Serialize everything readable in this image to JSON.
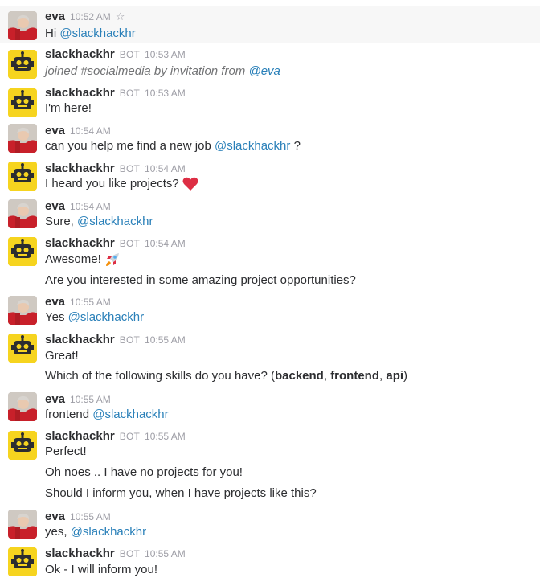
{
  "colors": {
    "mention": "#2a80b9",
    "meta": "#9e9ea6",
    "bot_avatar": "#f6d41f"
  },
  "eva_name": "eva",
  "bot_name": "slackhackhr",
  "bot_badge": "BOT",
  "messages": [
    {
      "time": "10:52 AM",
      "text": "Hi ",
      "mention": "@slackhackhr"
    },
    {
      "time": "10:53 AM",
      "text": "joined #socialmedia by invitation from ",
      "mention": "@eva"
    },
    {
      "time": "10:53 AM",
      "text": "I'm here!"
    },
    {
      "time": "10:54 AM",
      "text": "can you help me find a new job ",
      "mention": "@slackhackhr",
      "suffix": " ?"
    },
    {
      "time": "10:54 AM",
      "text": "I heard you like projects?",
      "emoji": "heart-emoji"
    },
    {
      "time": "10:54 AM",
      "text": "Sure, ",
      "mention": "@slackhackhr"
    },
    {
      "time": "10:54 AM",
      "text": "Awesome!",
      "emoji": "rocket-emoji",
      "line2": "Are you interested in some amazing project opportunities?"
    },
    {
      "time": "10:55 AM",
      "text": "Yes ",
      "mention": "@slackhackhr"
    },
    {
      "time": "10:55 AM",
      "text": "Great!",
      "line2_prefix": "Which of the following skills do you have? (",
      "skills": [
        "backend",
        "frontend",
        "api"
      ],
      "line2_suffix": ")"
    },
    {
      "time": "10:55 AM",
      "text": "frontend ",
      "mention": "@slackhackhr"
    },
    {
      "time": "10:55 AM",
      "text": "Perfect!",
      "line2": "Oh noes .. I have no projects for you!",
      "line3": "Should I inform you, when I have projects like this?"
    },
    {
      "time": "10:55 AM",
      "text": "yes, ",
      "mention": "@slackhackhr"
    },
    {
      "time": "10:55 AM",
      "text": "Ok - I will inform you!"
    }
  ]
}
